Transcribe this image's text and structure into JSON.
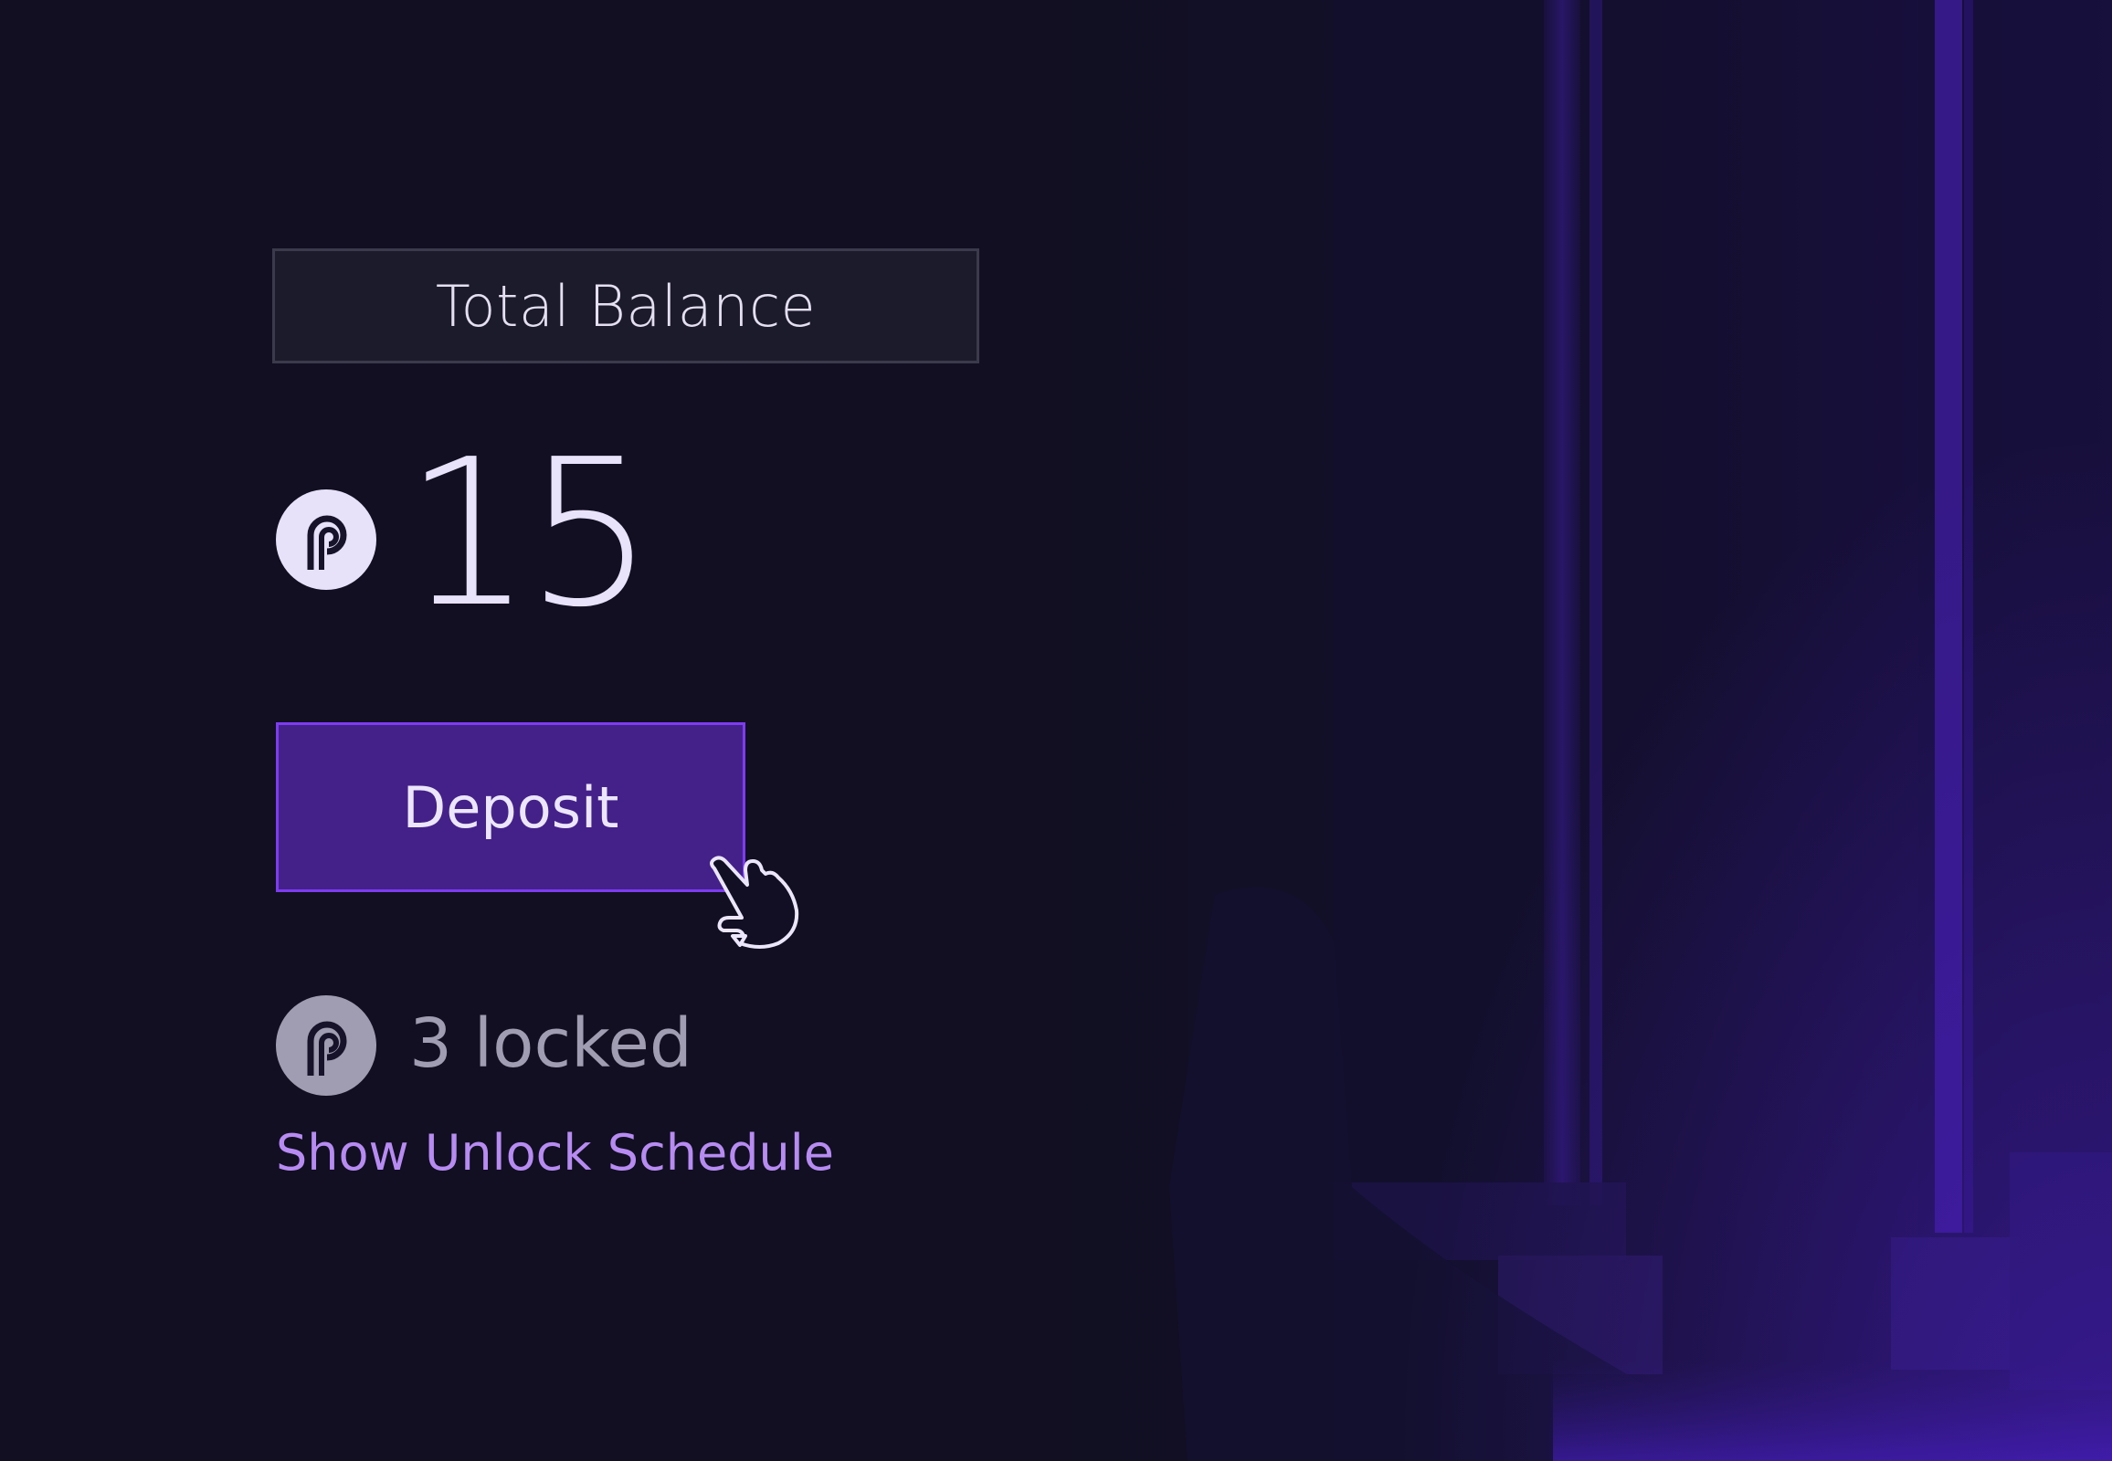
{
  "balance": {
    "label": "Total Balance",
    "amount": "15",
    "token_icon": "pyth-token-icon"
  },
  "actions": {
    "deposit_label": "Deposit",
    "cursor_icon": "pointer-hand-icon"
  },
  "locked": {
    "text": "3 locked",
    "token_icon": "pyth-token-icon"
  },
  "links": {
    "unlock_schedule": "Show Unlock Schedule"
  },
  "colors": {
    "background": "#110f21",
    "button": "#442189",
    "button_border": "#7d3cf0",
    "link": "#b78bf2",
    "accent_glow": "#5b23c9"
  }
}
